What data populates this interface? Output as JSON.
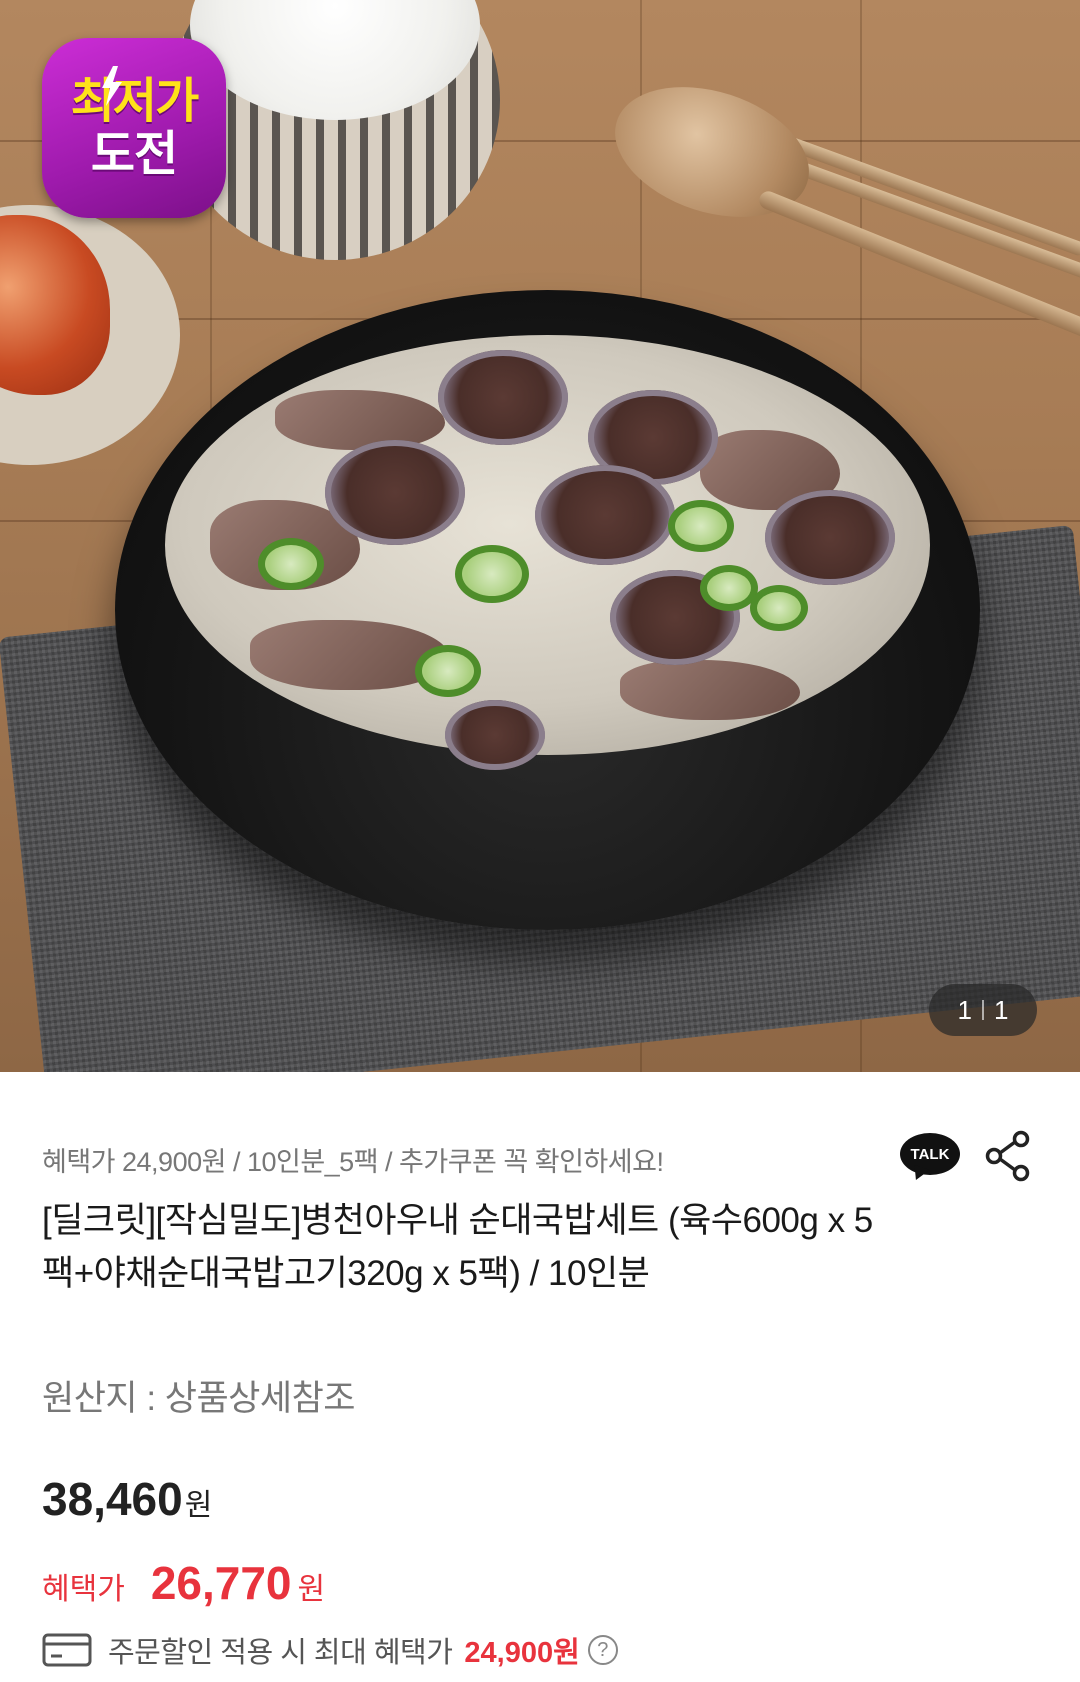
{
  "hero": {
    "badge_line1": "최저가",
    "badge_line2": "도전",
    "counter_current": "1",
    "counter_total": "1"
  },
  "product": {
    "promo_text": "혜택가 24,900원 / 10인분_5팩 / 추가쿠폰 꼭 확인하세요!",
    "talk_label": "TALK",
    "title": "[딜크릿][작심밀도]병천아우내 순대국밥세트 (육수600g x 5팩+야채순대국밥고기320g x 5팩) / 10인분",
    "origin": "원산지 : 상품상세참조",
    "price": "38,460",
    "price_unit": "원",
    "benefit_label": "혜택가",
    "benefit_price": "26,770",
    "benefit_unit": "원",
    "max_benefit_text": "주문할인 적용 시 최대 혜택가",
    "max_benefit_price": "24,900원",
    "help_glyph": "?"
  },
  "icons": {
    "share": "share-icon",
    "card": "card-icon",
    "help": "help-icon",
    "talk": "kakao-talk-icon"
  },
  "colors": {
    "accent_red": "#e8333d",
    "badge_purple": "#9e1aac",
    "badge_yellow": "#ffe21a"
  }
}
